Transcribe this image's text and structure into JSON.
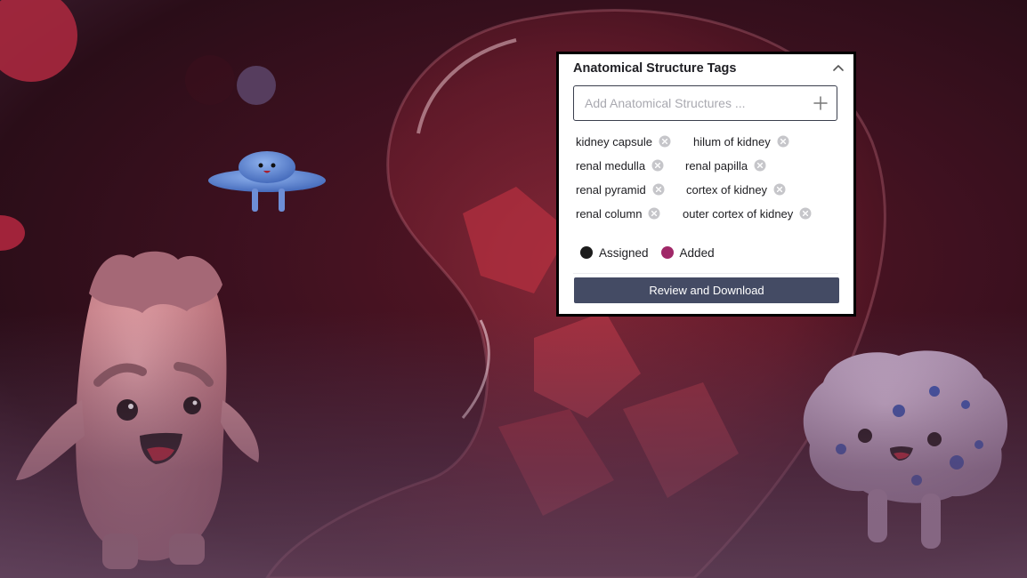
{
  "panel": {
    "title": "Anatomical Structure Tags",
    "collapse_icon": "chevron-up-icon",
    "search": {
      "placeholder": "Add Anatomical Structures ...",
      "value": "",
      "add_icon": "plus-icon"
    },
    "tags": [
      {
        "label": "kidney capsule",
        "status": "assigned"
      },
      {
        "label": "hilum of kidney",
        "status": "assigned"
      },
      {
        "label": "renal medulla",
        "status": "assigned"
      },
      {
        "label": "renal papilla",
        "status": "assigned"
      },
      {
        "label": "renal pyramid",
        "status": "assigned"
      },
      {
        "label": "cortex of kidney",
        "status": "assigned"
      },
      {
        "label": "renal column",
        "status": "assigned"
      },
      {
        "label": "outer cortex of kidney",
        "status": "assigned"
      }
    ],
    "remove_icon": "close-circle-icon",
    "legend": [
      {
        "label": "Assigned",
        "color": "#1c1c1c"
      },
      {
        "label": "Added",
        "color": "#a02868"
      }
    ],
    "review_button": "Review and Download"
  },
  "background": {
    "description_icons": [
      "organ-character-illustration",
      "ufo-character-illustration",
      "cell-character-illustration"
    ]
  }
}
